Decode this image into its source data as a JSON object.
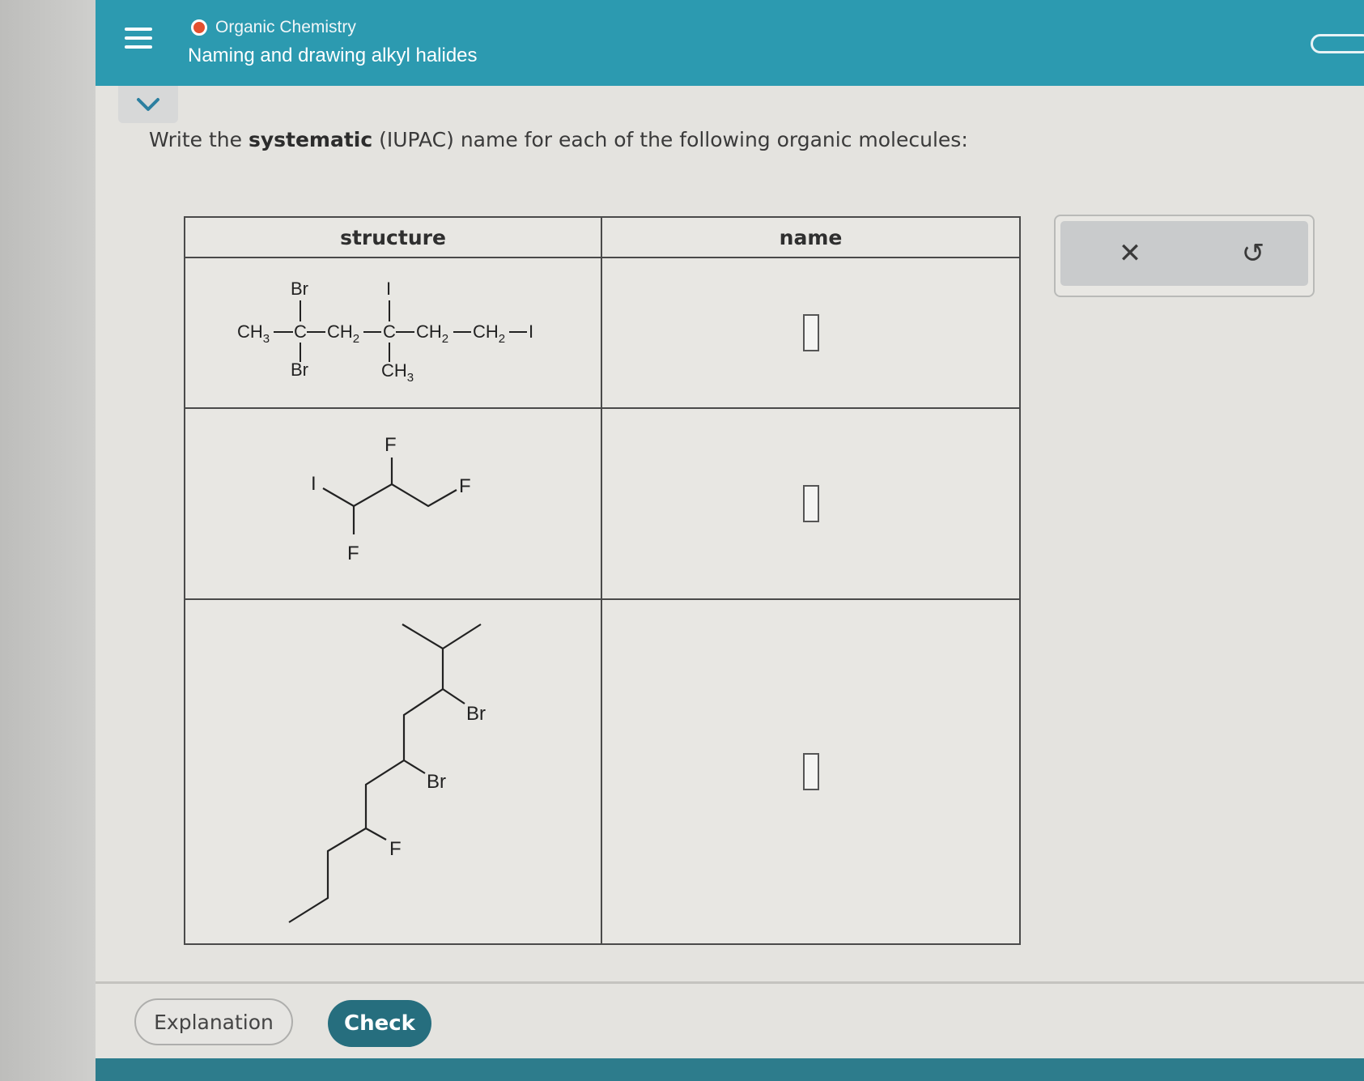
{
  "header": {
    "course": "Organic Chemistry",
    "topic": "Naming and drawing alkyl halides",
    "status_color": "#e4502f",
    "accent": "#2c9ab0"
  },
  "instruction": {
    "prefix": "Write the ",
    "bold": "systematic",
    "suffix": " (IUPAC) name for each of the following organic molecules:"
  },
  "table": {
    "headers": [
      "structure",
      "name"
    ],
    "rows": [
      {
        "structure": {
          "chain": [
            "CH",
            "3",
            "C",
            "CH",
            "2",
            "C",
            "CH",
            "2",
            "CH",
            "2",
            "I"
          ],
          "c2_top": "Br",
          "c2_bottom": "Br",
          "c4_top": "I",
          "c4_bottom_main": "CH",
          "c4_bottom_sub": "3"
        },
        "name_value": ""
      },
      {
        "structure": {
          "labels": [
            "I",
            "F",
            "F",
            "F"
          ]
        },
        "name_value": ""
      },
      {
        "structure": {
          "labels": [
            "Br",
            "Br",
            "F"
          ]
        },
        "name_value": ""
      }
    ]
  },
  "actions": {
    "clear_icon": "close-icon",
    "undo_icon": "undo-icon",
    "clear_glyph": "✕",
    "undo_glyph": "↺"
  },
  "footer": {
    "explanation": "Explanation",
    "check": "Check"
  }
}
